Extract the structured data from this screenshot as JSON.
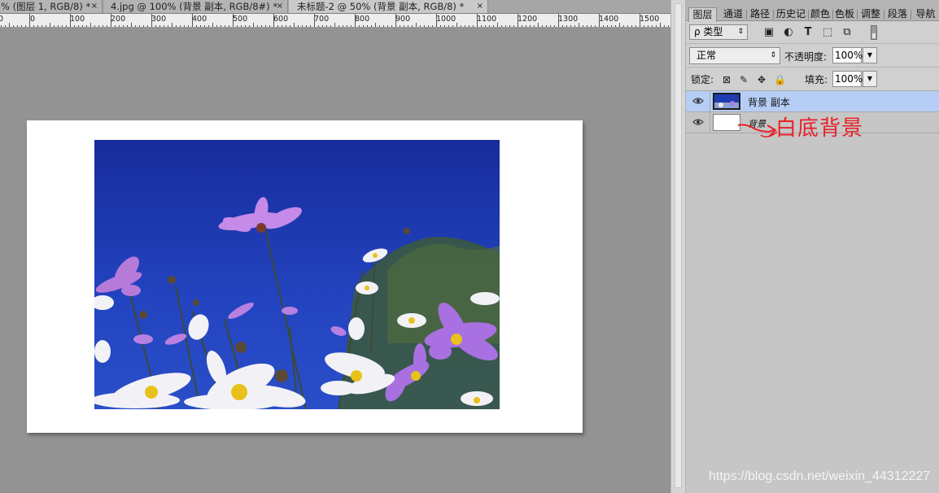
{
  "document_tabs": [
    {
      "label": "% (图层 1, RGB/8) *",
      "close": "×"
    },
    {
      "label": "4.jpg @ 100% (背景 副本, RGB/8#) *",
      "close": "×"
    },
    {
      "label": "未标题-2 @ 50% (背景 副本, RGB/8) *",
      "close": "×"
    }
  ],
  "ruler": {
    "labels": [
      "0",
      "0",
      "100",
      "200",
      "300",
      "400",
      "500",
      "600",
      "700",
      "800",
      "900",
      "1000",
      "1100",
      "1200",
      "1300",
      "1400",
      "1500"
    ]
  },
  "panel_tabs": [
    "图层",
    "通道",
    "路径",
    "历史记",
    "颜色",
    "色板",
    "调整",
    "段落",
    "导航"
  ],
  "layers_panel": {
    "kind_filter": "ρ 类型",
    "blend_mode": "正常",
    "opacity_label": "不透明度:",
    "opacity_value": "100%",
    "lock_label": "锁定:",
    "fill_label": "填充:",
    "fill_value": "100%",
    "layers": [
      {
        "name": "背景 副本",
        "visible": true,
        "selected": true
      },
      {
        "name": "背景",
        "visible": true,
        "selected": false
      }
    ]
  },
  "annotation": {
    "text": "白底背景",
    "color": "#e8222a"
  },
  "watermark": "https://blog.csdn.net/weixin_44312227",
  "colors": {
    "sky": "#1c35a8",
    "selection": "#b6cef5",
    "canvas_bg": "#939393"
  }
}
